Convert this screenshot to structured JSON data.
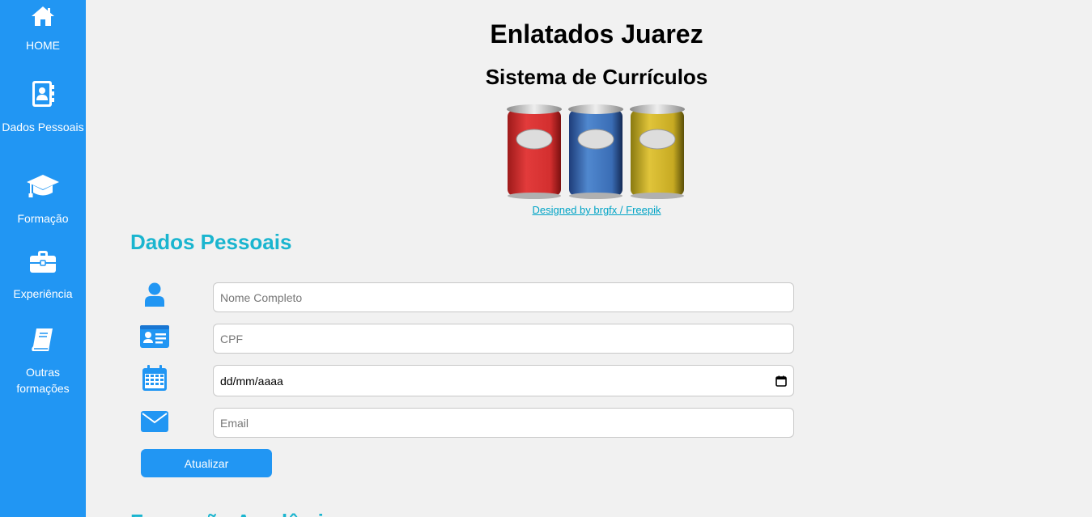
{
  "sidebar": {
    "items": [
      {
        "label": "HOME",
        "icon": "home-icon"
      },
      {
        "label": "Dados Pessoais",
        "icon": "address-book-icon"
      },
      {
        "label": "Formação",
        "icon": "graduation-cap-icon"
      },
      {
        "label": "Experiência",
        "icon": "briefcase-icon"
      },
      {
        "label": "Outras formações",
        "icon": "book-icon"
      }
    ]
  },
  "header": {
    "title": "Enlatados Juarez",
    "subtitle": "Sistema de Currículos",
    "credit": "Designed by brgfx / Freepik"
  },
  "form": {
    "section_title": "Dados Pessoais",
    "fields": [
      {
        "placeholder": "Nome Completo",
        "icon": "user-icon"
      },
      {
        "placeholder": "CPF",
        "icon": "id-card-icon"
      },
      {
        "value": "dd/mm/aaaa",
        "icon": "calendar-icon"
      },
      {
        "placeholder": "Email",
        "icon": "envelope-icon"
      }
    ],
    "submit_label": "Atualizar"
  },
  "next_section": {
    "title": "Formação Acadêmica"
  },
  "colors": {
    "sidebar": "#2196f3",
    "accent": "#1ab5cf",
    "background": "#f1f1f1"
  }
}
